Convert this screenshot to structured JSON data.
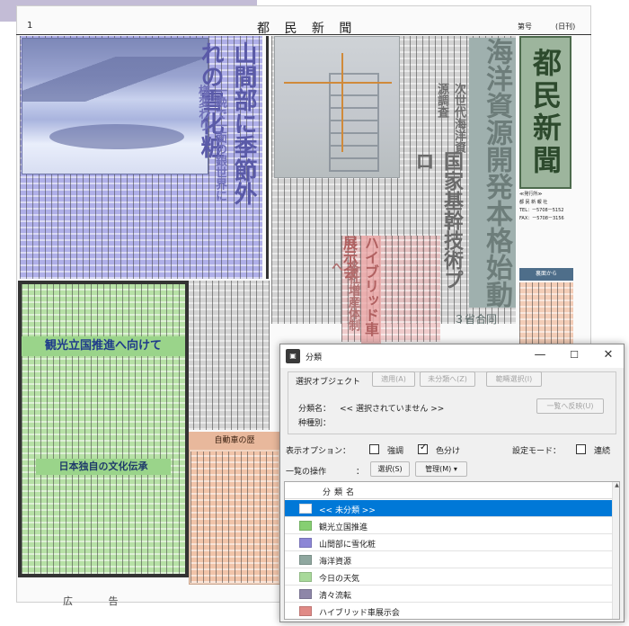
{
  "newspaper": {
    "page_number": "1",
    "paper_name": "都 民 新 聞",
    "issue_label": "第号",
    "weekday_label": "(日刊)",
    "masthead": "都民新聞",
    "publisher_label": "≪発行所≫",
    "publisher_name": "都 民 新 報 社",
    "tel": "TEL：ー5708ー5152",
    "fax": "FAX：ー5708ー3156",
    "inner_pages_label": "裏面から",
    "headlines": {
      "snow": "山間部に季節外れの雪化粧",
      "snow_sub": "一晩で一面の銀世界に様変わり",
      "ocean": "海洋資源開発本格始動",
      "ocean_sub": "次世代海洋資源調査",
      "national": "国家基幹技術プロ",
      "three_ministries": "３省合同",
      "hybrid": "ハイブリッド車展示会",
      "hybrid_sub": "各社増産体制へ",
      "tourism": "観光立国推進へ向けて",
      "culture": "日本独自の文化伝承",
      "auto_history": "自動車の歴",
      "ad": "広 告"
    }
  },
  "dialog": {
    "title": "分類",
    "window_controls": {
      "minimize": "—",
      "maximize": "☐",
      "close": "✕"
    },
    "selection_group": {
      "label": "選択オブジェクト",
      "apply_button": "適用(A)",
      "unclassify_button": "未分類へ(Z)",
      "select_range_button": "範疇選択(I)",
      "reflect_button": "一覧へ反映(U)",
      "classification_name_label": "分類名：",
      "classification_name_value": "<< 選択されていません >>",
      "type_label": "种種別："
    },
    "display_options": {
      "label": "表示オプション：",
      "emphasis_label": "強調",
      "emphasis_checked": false,
      "colorize_label": "色分け",
      "colorize_checked": true
    },
    "setting_mode": {
      "label": "設定モード：",
      "continuous_label": "連続",
      "continuous_checked": false
    },
    "list_operations": {
      "label": "一覧の操作",
      "colon": "：",
      "select_button": "選択(S)",
      "manage_button": "管理(M) ▾"
    },
    "list": {
      "column_header": "分類名",
      "rows": [
        {
          "label": "<< 未分類 >>",
          "color": "#ffffff",
          "selected": true
        },
        {
          "label": "観光立国推進",
          "color": "#86cf72",
          "selected": false
        },
        {
          "label": "山間部に雪化粧",
          "color": "#8c86d6",
          "selected": false
        },
        {
          "label": "海洋資源",
          "color": "#8fa79f",
          "selected": false
        },
        {
          "label": "今日の天気",
          "color": "#a8d99a",
          "selected": false
        },
        {
          "label": "清々流転",
          "color": "#8e86a8",
          "selected": false
        },
        {
          "label": "ハイブリッド車展示会",
          "color": "#e08a86",
          "selected": false
        }
      ]
    }
  }
}
